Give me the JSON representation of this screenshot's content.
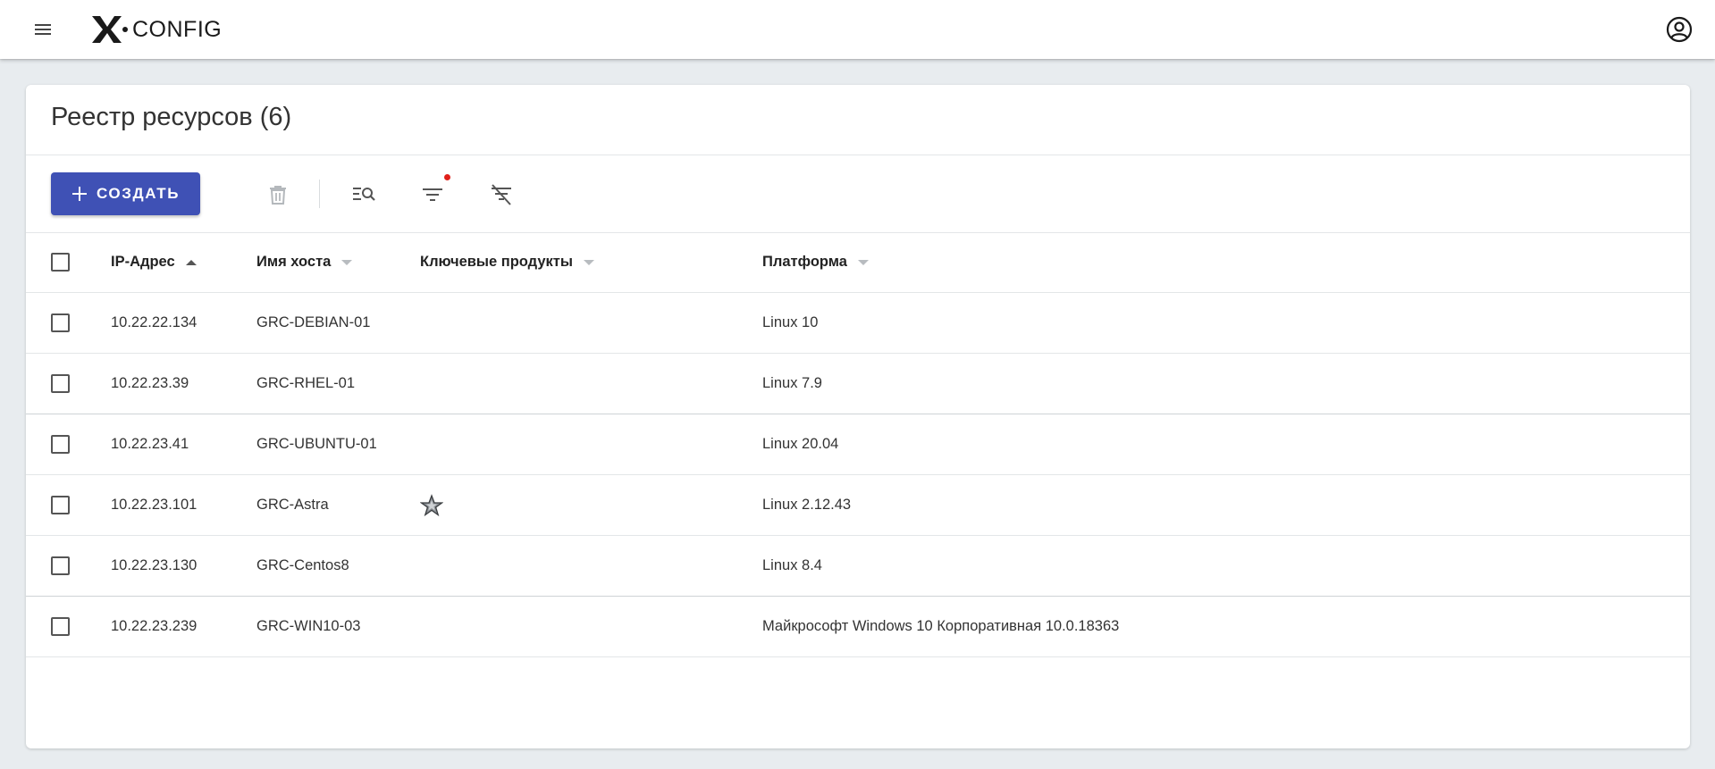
{
  "app": {
    "brand_mark": "X",
    "brand_word": "CONFIG",
    "icons": {
      "menu": "hamburger-menu-icon",
      "account": "account-circle-icon"
    }
  },
  "page": {
    "title": "Реестр ресурсов (6)"
  },
  "toolbar": {
    "create_label": "СОЗДАТЬ",
    "accent_color": "#3f51b5",
    "icons": [
      "delete-icon",
      "search-list-icon",
      "filter-icon",
      "clear-filter-icon"
    ],
    "filter_badge_color": "#e0201a"
  },
  "table": {
    "columns": [
      "IP-Адрес",
      "Имя хоста",
      "Ключевые продукты",
      "Платформа"
    ],
    "sort": {
      "column": "IP-Адрес",
      "direction": "asc"
    },
    "rows": [
      {
        "ip": "10.22.22.134",
        "host": "GRC-DEBIAN-01",
        "product_icon": "",
        "platform": "Linux 10"
      },
      {
        "ip": "10.22.23.39",
        "host": "GRC-RHEL-01",
        "product_icon": "",
        "platform": "Linux 7.9"
      },
      {
        "ip": "10.22.23.41",
        "host": "GRC-UBUNTU-01",
        "product_icon": "",
        "platform": "Linux 20.04"
      },
      {
        "ip": "10.22.23.101",
        "host": "GRC-Astra",
        "product_icon": "astra-star-icon",
        "platform": "Linux 2.12.43"
      },
      {
        "ip": "10.22.23.130",
        "host": "GRC-Centos8",
        "product_icon": "",
        "platform": "Linux 8.4"
      },
      {
        "ip": "10.22.23.239",
        "host": "GRC-WIN10-03",
        "product_icon": "",
        "platform": "Майкрософт Windows 10 Корпоративная 10.0.18363"
      }
    ]
  }
}
